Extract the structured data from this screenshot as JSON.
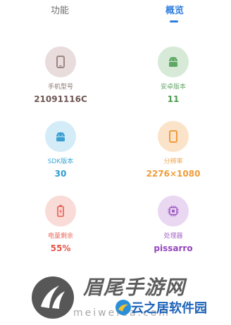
{
  "tabs": [
    {
      "label": "功能",
      "active": false
    },
    {
      "label": "概览",
      "active": true
    }
  ],
  "accent_color": "#2f7fe0",
  "cards": [
    {
      "label": "手机型号",
      "value": "21091116C",
      "icon": "phone-icon",
      "bg": "#e8dddc",
      "label_color": "#8a7470",
      "value_color": "#6e5753"
    },
    {
      "label": "安卓版本",
      "value": "11",
      "icon": "android-icon",
      "bg": "#d7ead8",
      "label_color": "#67a96a",
      "value_color": "#4c9b50"
    },
    {
      "label": "SDK版本",
      "value": "30",
      "icon": "sdk-chip-icon",
      "bg": "#d3ecf7",
      "label_color": "#3aa7d8",
      "value_color": "#2d9bd0"
    },
    {
      "label": "分辨率",
      "value": "2276×1080",
      "icon": "screen-icon",
      "bg": "#fbe3c9",
      "label_color": "#f0a44a",
      "value_color": "#ee9c3a"
    },
    {
      "label": "电量剩余",
      "value": "55%",
      "icon": "battery-icon",
      "bg": "#f9dbd8",
      "label_color": "#ea6a5e",
      "value_color": "#e5564a"
    },
    {
      "label": "处理器",
      "value": "pissarro",
      "icon": "processor-icon",
      "bg": "#ead8f2",
      "label_color": "#a566c6",
      "value_color": "#9446bd"
    }
  ],
  "watermark": {
    "title": "眉尾手游网",
    "domain": "meiwelda.com",
    "site": "云之居软件园"
  }
}
